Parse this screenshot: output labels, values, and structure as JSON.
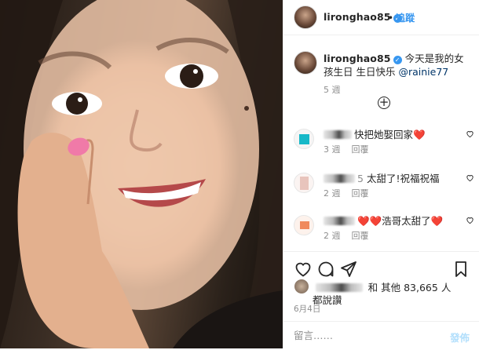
{
  "header": {
    "username": "lironghao85",
    "verified_glyph": "✓",
    "separator": "•",
    "follow_label": "追蹤"
  },
  "caption": {
    "username": "lironghao85",
    "text": "今天是我的女孩生日 生日快乐",
    "mention": "@rainie77",
    "time": "5 週"
  },
  "load_more_glyph": "+",
  "comments": [
    {
      "text": "快把她娶回家",
      "emoji": "❤️",
      "time": "3 週",
      "reply_label": "回覆",
      "avatar_color": "#17b8c8"
    },
    {
      "text_prefix": "5",
      "text": "太甜了!祝福祝福",
      "time": "2 週",
      "reply_label": "回覆",
      "avatar_color": "#e8c4bc"
    },
    {
      "emoji_prefix": "❤️❤️",
      "text": "浩哥太甜了",
      "emoji": "❤️",
      "time": "2 週",
      "reply_label": "回覆",
      "avatar_color": "#f08a5d"
    }
  ],
  "likes": {
    "text": "和 其他 83,665 人",
    "text_line2": "都說讚"
  },
  "date": "6月4日",
  "comment_box": {
    "placeholder": "留言……",
    "post_label": "發佈"
  },
  "colors": {
    "accent_blue": "#3897f0",
    "mention_blue": "#003569",
    "meta_gray": "#8e8e8e",
    "heart_red": "#e0152b"
  },
  "icons": [
    "heart-outline-icon",
    "comment-icon",
    "share-icon",
    "bookmark-icon",
    "verified-badge-icon",
    "plus-circle-icon"
  ]
}
